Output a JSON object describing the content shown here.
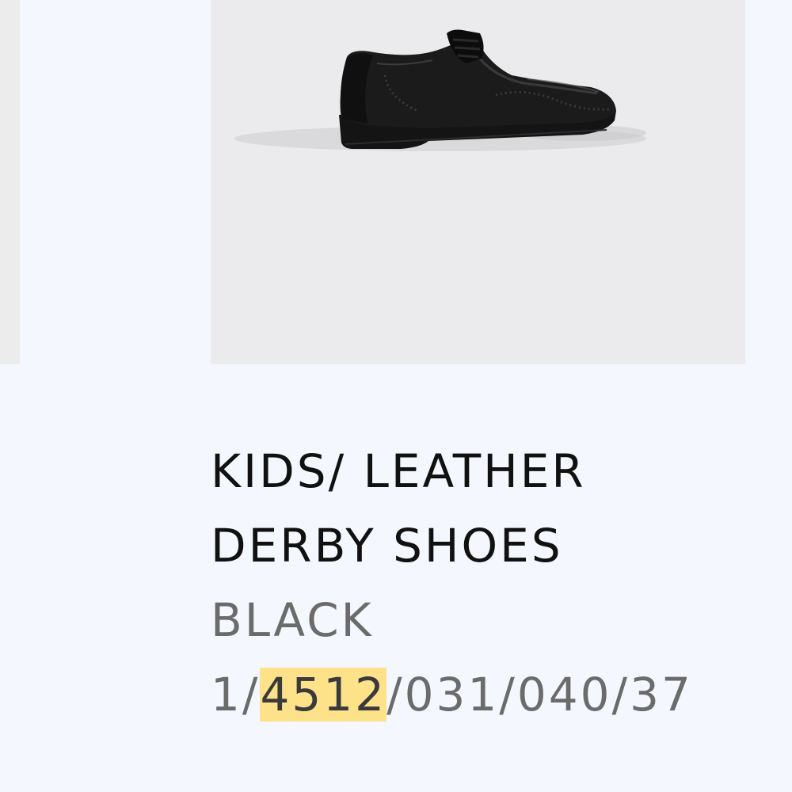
{
  "product": {
    "image_alt": "Black leather derby shoe",
    "name": "KIDS/ LEATHER DERBY SHOES",
    "color": "BLACK",
    "reference": {
      "prefix": "1/",
      "highlight": "4512",
      "suffix": "/031/040/37"
    }
  },
  "colors": {
    "background": "#f4f7fd",
    "image_background": "#ebebed",
    "highlight": "#fde28a",
    "title_text": "#111111",
    "secondary_text": "#6b6b6b"
  }
}
